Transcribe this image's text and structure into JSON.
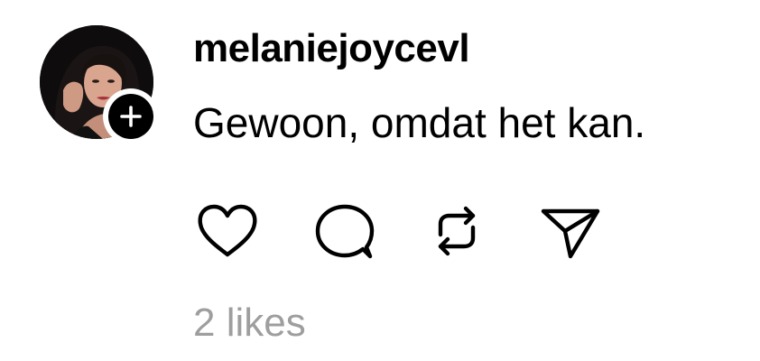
{
  "post": {
    "author": {
      "username": "melaniejoycevl",
      "avatar_icon": "profile-photo",
      "follow_icon": "plus-icon"
    },
    "text": "Gewoon, omdat het kan.",
    "actions": [
      {
        "icon": "heart-icon",
        "action": "like"
      },
      {
        "icon": "comment-icon",
        "action": "comment"
      },
      {
        "icon": "repost-icon",
        "action": "repost"
      },
      {
        "icon": "send-icon",
        "action": "share"
      }
    ],
    "likes_label": "2 likes"
  },
  "colors": {
    "background": "#ffffff",
    "text": "#000000",
    "muted": "#9e9e9e"
  }
}
